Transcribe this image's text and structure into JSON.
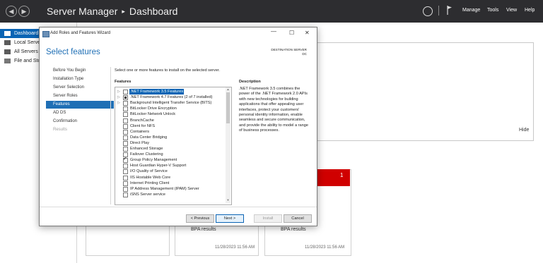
{
  "server_manager": {
    "title": "Server Manager",
    "separator": "▸",
    "page": "Dashboard",
    "menu": [
      "Manage",
      "Tools",
      "View",
      "Help"
    ],
    "nav": [
      "Dashboard",
      "Local Server",
      "All Servers",
      "File and Storage Services"
    ],
    "hide_label": "Hide",
    "tile_count": "1",
    "tiles": [
      {
        "bpa": "BPA results",
        "time": "11/28/2023 11:56 AM"
      },
      {
        "bpa": "BPA results",
        "time": "11/28/2023 11:56 AM"
      }
    ]
  },
  "wizard": {
    "title": "Add Roles and Features Wizard",
    "minimize": "—",
    "maximize": "☐",
    "close": "✕",
    "heading": "Select features",
    "destination_label": "DESTINATION SERVER",
    "destination_value": "DC",
    "steps": [
      {
        "label": "Before You Begin",
        "state": "normal"
      },
      {
        "label": "Installation Type",
        "state": "normal"
      },
      {
        "label": "Server Selection",
        "state": "normal"
      },
      {
        "label": "Server Roles",
        "state": "normal"
      },
      {
        "label": "Features",
        "state": "current"
      },
      {
        "label": "AD DS",
        "state": "normal"
      },
      {
        "label": "Confirmation",
        "state": "normal"
      },
      {
        "label": "Results",
        "state": "disabled"
      }
    ],
    "intro": "Select one or more features to install on the selected server.",
    "features_header": "Features",
    "description_header": "Description",
    "features": [
      {
        "label": ".NET Framework 3.5 Features",
        "expandable": true,
        "state": "unchecked",
        "selected": true
      },
      {
        "label": ".NET Framework 4.7 Features (2 of 7 installed)",
        "expandable": true,
        "state": "partial",
        "selected": false
      },
      {
        "label": "Background Intelligent Transfer Service (BITS)",
        "expandable": true,
        "state": "unchecked",
        "selected": false
      },
      {
        "label": "BitLocker Drive Encryption",
        "expandable": false,
        "state": "unchecked",
        "selected": false
      },
      {
        "label": "BitLocker Network Unlock",
        "expandable": false,
        "state": "unchecked",
        "selected": false
      },
      {
        "label": "BranchCache",
        "expandable": false,
        "state": "unchecked",
        "selected": false
      },
      {
        "label": "Client for NFS",
        "expandable": false,
        "state": "unchecked",
        "selected": false
      },
      {
        "label": "Containers",
        "expandable": false,
        "state": "unchecked",
        "selected": false
      },
      {
        "label": "Data Center Bridging",
        "expandable": false,
        "state": "unchecked",
        "selected": false
      },
      {
        "label": "Direct Play",
        "expandable": false,
        "state": "unchecked",
        "selected": false
      },
      {
        "label": "Enhanced Storage",
        "expandable": false,
        "state": "unchecked",
        "selected": false
      },
      {
        "label": "Failover Clustering",
        "expandable": false,
        "state": "unchecked",
        "selected": false
      },
      {
        "label": "Group Policy Management",
        "expandable": false,
        "state": "checked",
        "selected": false
      },
      {
        "label": "Host Guardian Hyper-V Support",
        "expandable": false,
        "state": "unchecked",
        "selected": false
      },
      {
        "label": "I/O Quality of Service",
        "expandable": false,
        "state": "unchecked",
        "selected": false
      },
      {
        "label": "IIS Hostable Web Core",
        "expandable": false,
        "state": "unchecked",
        "selected": false
      },
      {
        "label": "Internet Printing Client",
        "expandable": false,
        "state": "unchecked",
        "selected": false
      },
      {
        "label": "IP Address Management (IPAM) Server",
        "expandable": false,
        "state": "unchecked",
        "selected": false
      },
      {
        "label": "iSNS Server service",
        "expandable": false,
        "state": "unchecked",
        "selected": false
      }
    ],
    "description_text": ".NET Framework 3.5 combines the power of the .NET Framework 2.0 APIs with new technologies for building applications that offer appealing user interfaces, protect your customers' personal identity information, enable seamless and secure communication, and provide the ability to model a range of business processes.",
    "buttons": {
      "previous": "< Previous",
      "next": "Next >",
      "install": "Install",
      "cancel": "Cancel"
    }
  },
  "colors": {
    "accent": "#1f6fb5",
    "title_bar": "#2d2d30",
    "alert": "#d00000"
  }
}
